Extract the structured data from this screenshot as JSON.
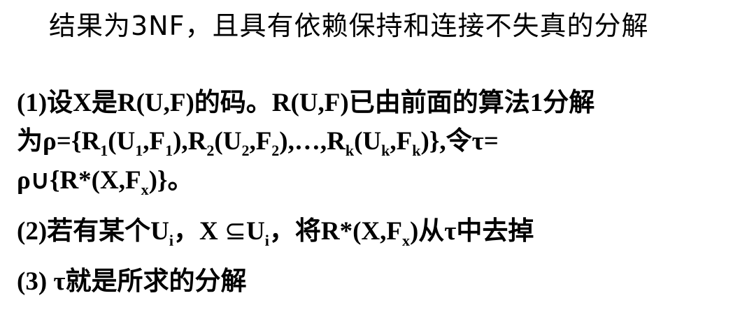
{
  "title": "结果为3NF，且具有依赖保持和连接不失真的分解",
  "step1": {
    "line1": "(1)设X是R(U,F)的码。R(U,F)已由前面的算法1分解",
    "line2": {
      "pre": "为ρ={R",
      "r1_sub": "1",
      "a": "(U",
      "u1_sub": "1",
      "b": ",F",
      "f1_sub": "1",
      "c": "),R",
      "r2_sub": "2",
      "d": "(U",
      "u2_sub": "2",
      "e": ",F",
      "f2_sub": "2",
      "f": "),…,R",
      "rk_sub": "k",
      "g": "(U",
      "uk_sub": "k",
      "h": ",F",
      "fk_sub": "k",
      "post": ")},令τ="
    },
    "line3": {
      "pre": "ρ∪{R*(X,F",
      "fx_sub": "x",
      "post": ")}。"
    }
  },
  "step2": {
    "pre": "(2)若有某个U",
    "ui_sub": "i",
    "mid1": "，X ",
    "subseteq": "⊆",
    "mid2": "U",
    "ui2_sub": "i",
    "mid3": "，将R*(X,F",
    "fx_sub": "x",
    "post": ")从τ中去掉"
  },
  "step3": "(3) τ就是所求的分解"
}
